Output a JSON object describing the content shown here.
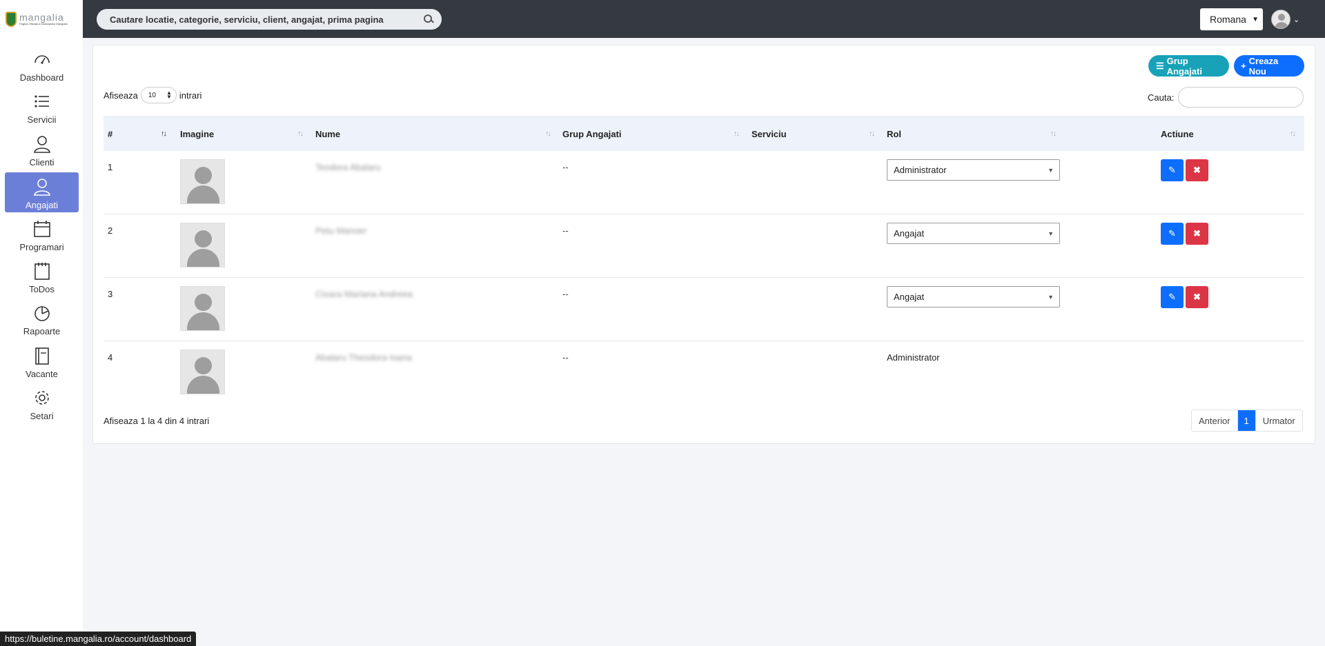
{
  "header": {
    "logo_name": "mangalia",
    "logo_sub": "Pagina Oficiala a Municipiului Mangalia",
    "search_placeholder": "Cautare locatie, categorie, serviciu, client, angajat, prima pagina",
    "language": "Romana"
  },
  "sidebar": {
    "items": [
      {
        "label": "Dashboard",
        "icon": "speedometer-icon"
      },
      {
        "label": "Servicii",
        "icon": "list-icon"
      },
      {
        "label": "Clienti",
        "icon": "user-icon"
      },
      {
        "label": "Angajati",
        "icon": "user-icon",
        "active": true
      },
      {
        "label": "Programari",
        "icon": "calendar-icon"
      },
      {
        "label": "ToDos",
        "icon": "notepad-icon"
      },
      {
        "label": "Rapoarte",
        "icon": "pie-chart-icon"
      },
      {
        "label": "Vacante",
        "icon": "book-icon"
      },
      {
        "label": "Setari",
        "icon": "gear-icon"
      }
    ]
  },
  "toolbar": {
    "group_label": "Grup Angajati",
    "create_label": "Creaza Nou"
  },
  "table_controls": {
    "show_prefix": "Afiseaza",
    "page_length": "10",
    "show_suffix": "intrari",
    "search_label": "Cauta:"
  },
  "table": {
    "columns": [
      "#",
      "Imagine",
      "Nume",
      "Grup Angajati",
      "Serviciu",
      "Rol",
      "Actiune"
    ],
    "rows": [
      {
        "num": "1",
        "name": "Teodora Abalaru",
        "group": "--",
        "service": "",
        "role": "Administrator",
        "role_editable": true
      },
      {
        "num": "2",
        "name": "Petu Manoer",
        "group": "--",
        "service": "",
        "role": "Angajat",
        "role_editable": true
      },
      {
        "num": "3",
        "name": "Cioara Mariana Andreea",
        "group": "--",
        "service": "",
        "role": "Angajat",
        "role_editable": true
      },
      {
        "num": "4",
        "name": "Abalaru Theodora Ioana",
        "group": "--",
        "service": "",
        "role": "Administrator",
        "role_editable": false
      }
    ]
  },
  "footer": {
    "info": "Afiseaza 1 la 4 din 4 intrari",
    "prev": "Anterior",
    "page": "1",
    "next": "Urmator"
  },
  "status_url": "https://buletine.mangalia.ro/account/dashboard",
  "colors": {
    "topbar": "#343a40",
    "active_nav": "#6c7fd8",
    "primary": "#0d6efd",
    "teal": "#17a2b8",
    "danger": "#dc3545"
  }
}
